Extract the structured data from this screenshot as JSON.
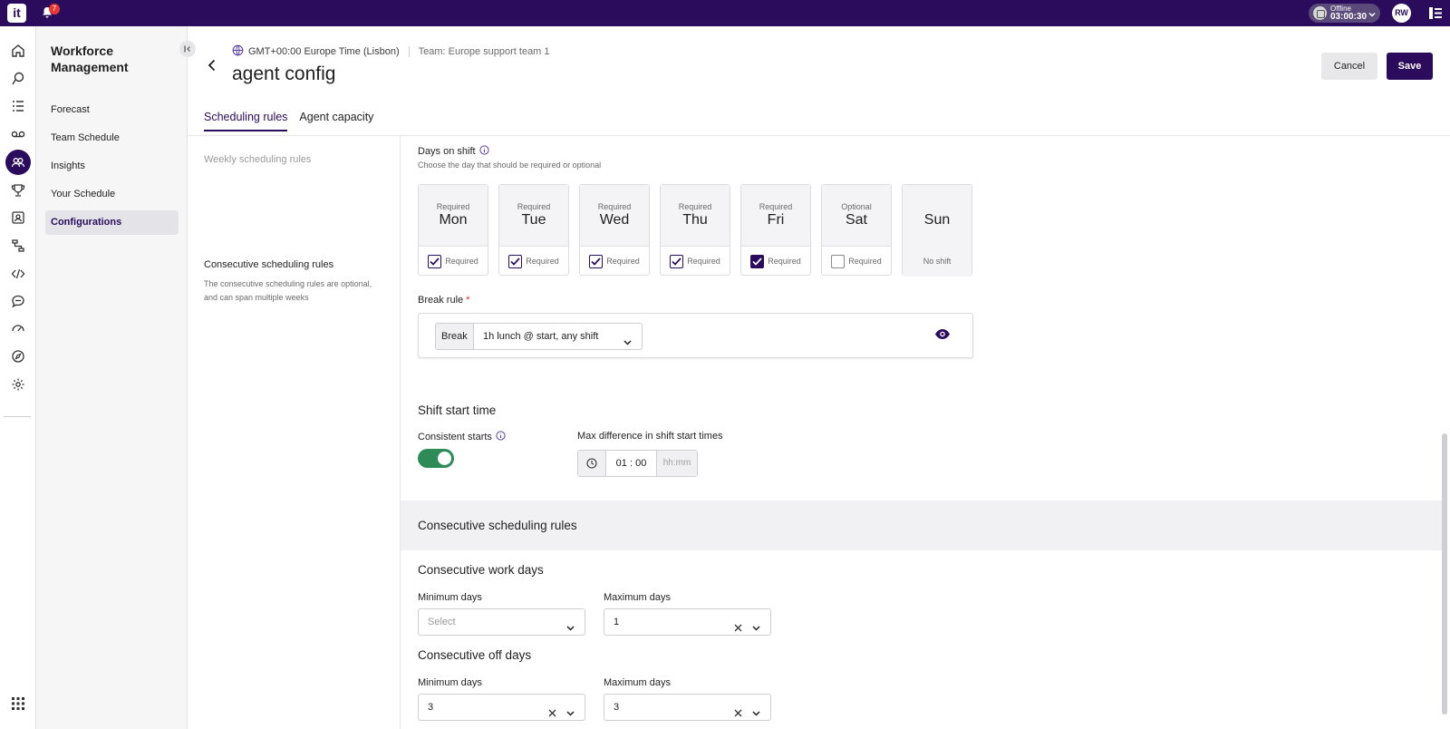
{
  "topbar": {
    "logo": "it",
    "notification_count": "7",
    "status_label": "Offline",
    "status_time": "03:00:30",
    "avatar_initials": "RW"
  },
  "sidenav": {
    "title": "Workforce Management",
    "items": [
      {
        "label": "Forecast"
      },
      {
        "label": "Team Schedule"
      },
      {
        "label": "Insights"
      },
      {
        "label": "Your Schedule"
      },
      {
        "label": "Configurations"
      }
    ]
  },
  "header": {
    "timezone": "GMT+00:00 Europe Time (Lisbon)",
    "team": "Team: Europe support team 1",
    "title": "agent config",
    "cancel_label": "Cancel",
    "save_label": "Save"
  },
  "tabs": [
    {
      "label": "Scheduling rules"
    },
    {
      "label": "Agent capacity"
    }
  ],
  "left_sections": {
    "weekly": "Weekly scheduling rules",
    "consecutive": "Consecutive scheduling rules",
    "consecutive_desc": "The consecutive scheduling rules are optional, and can span multiple weeks"
  },
  "days_on_shift": {
    "label": "Days on shift",
    "hint": "Choose the day that should be required or optional",
    "checkbox_label": "Required",
    "days": [
      {
        "status": "Required",
        "name": "Mon",
        "checked": true
      },
      {
        "status": "Required",
        "name": "Tue",
        "checked": true
      },
      {
        "status": "Required",
        "name": "Wed",
        "checked": true
      },
      {
        "status": "Required",
        "name": "Thu",
        "checked": true
      },
      {
        "status": "Required",
        "name": "Fri",
        "checked": true
      },
      {
        "status": "Optional",
        "name": "Sat",
        "checked": false
      },
      {
        "status": "",
        "name": "Sun",
        "no_shift": "No shift"
      }
    ]
  },
  "break_rule": {
    "label": "Break rule",
    "required_mark": "*",
    "prefix": "Break",
    "value": "1h lunch @ start, any shift"
  },
  "shift_start": {
    "heading": "Shift start time",
    "consistent_label": "Consistent starts",
    "consistent_on": true,
    "max_diff_label": "Max difference in shift start times",
    "max_diff_value": "01 : 00",
    "max_diff_unit": "hh:mm"
  },
  "consecutive": {
    "band_title": "Consecutive scheduling rules",
    "work_days": {
      "heading": "Consecutive work days",
      "min_label": "Minimum days",
      "min_placeholder": "Select",
      "max_label": "Maximum days",
      "max_value": "1"
    },
    "off_days": {
      "heading": "Consecutive off days",
      "min_label": "Minimum days",
      "min_value": "3",
      "max_label": "Maximum days",
      "max_value": "3"
    }
  },
  "colors": {
    "brand": "#2a0b5c",
    "toggle_on": "#2e8b57"
  }
}
